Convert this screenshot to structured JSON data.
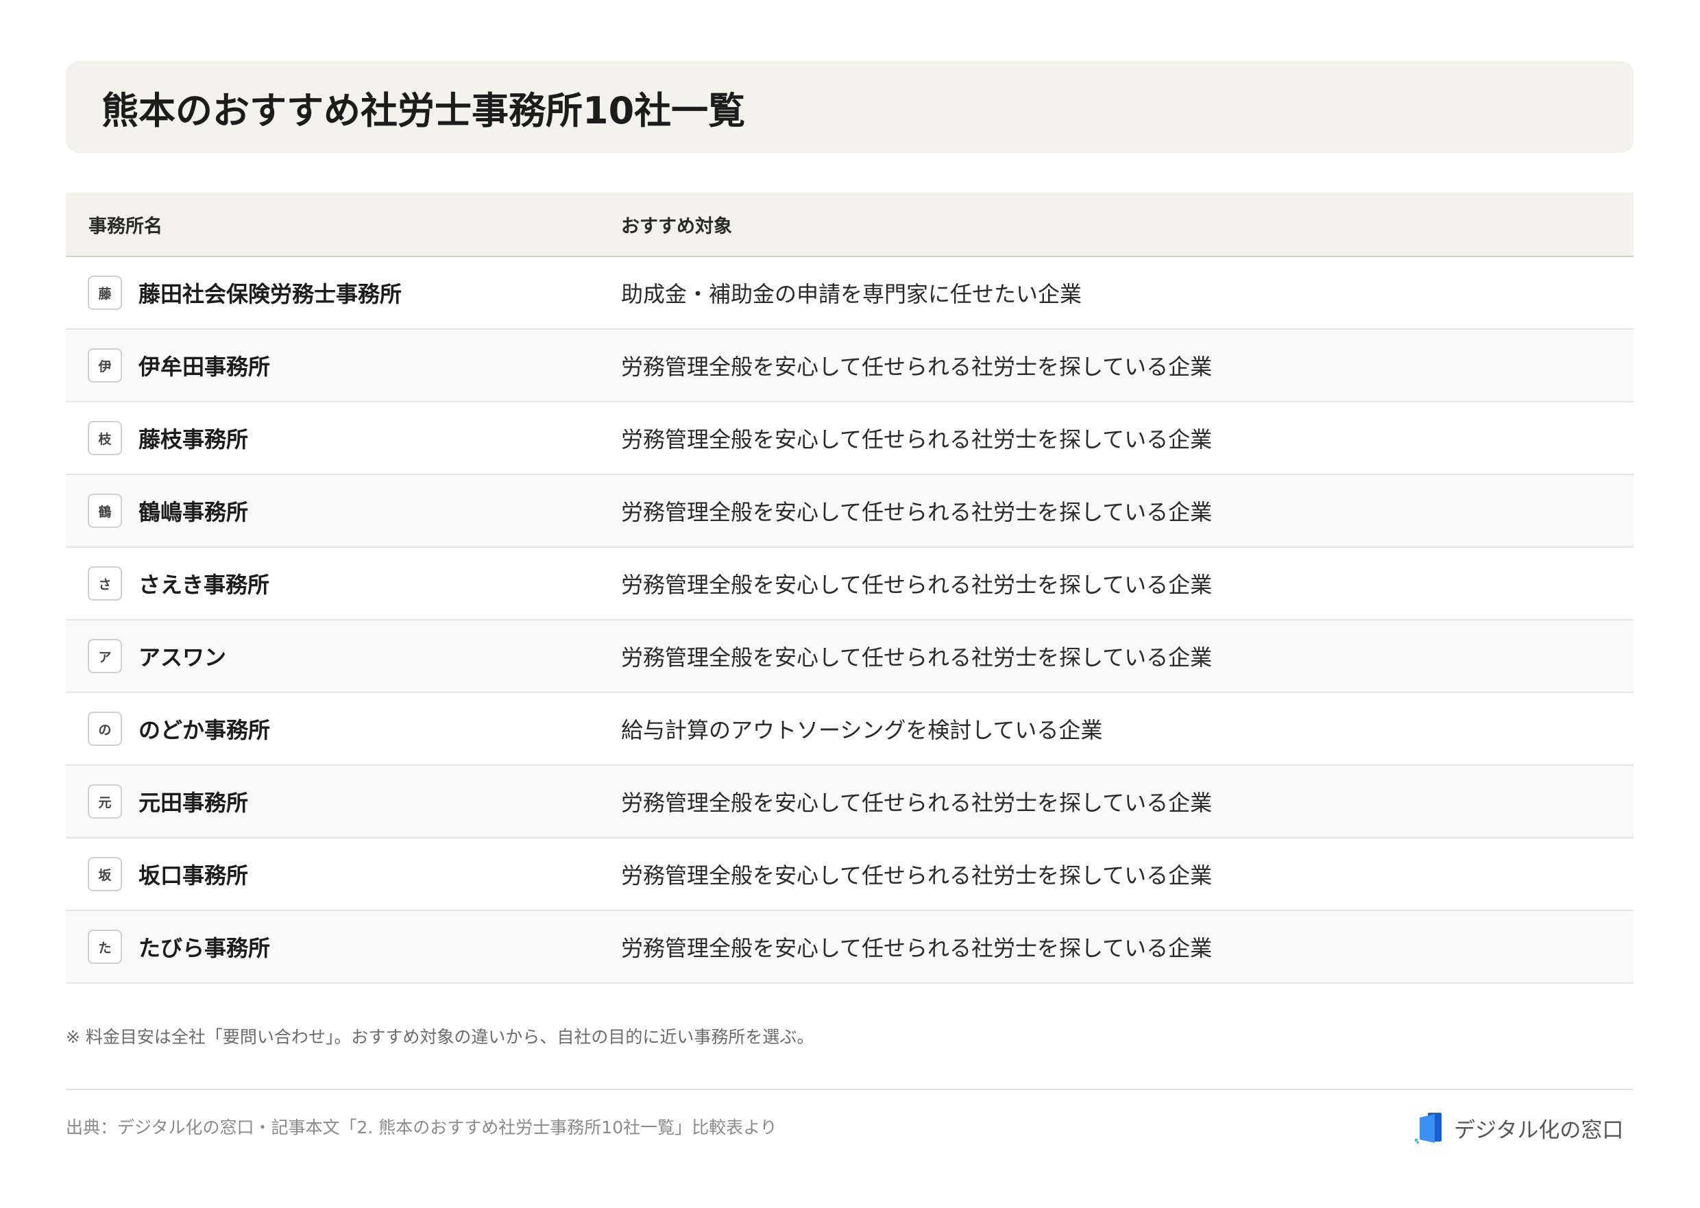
{
  "title": "熊本のおすすめ社労士事務所10社一覧",
  "table": {
    "headers": {
      "name": "事務所名",
      "target": "おすすめ対象"
    },
    "rows": [
      {
        "initial": "藤",
        "name": "藤田社会保険労務士事務所",
        "target": "助成金・補助金の申請を専門家に任せたい企業"
      },
      {
        "initial": "伊",
        "name": "伊牟田事務所",
        "target": "労務管理全般を安心して任せられる社労士を探している企業"
      },
      {
        "initial": "枝",
        "name": "藤枝事務所",
        "target": "労務管理全般を安心して任せられる社労士を探している企業"
      },
      {
        "initial": "鶴",
        "name": "鶴嶋事務所",
        "target": "労務管理全般を安心して任せられる社労士を探している企業"
      },
      {
        "initial": "さ",
        "name": "さえき事務所",
        "target": "労務管理全般を安心して任せられる社労士を探している企業"
      },
      {
        "initial": "ア",
        "name": "アスワン",
        "target": "労務管理全般を安心して任せられる社労士を探している企業"
      },
      {
        "initial": "の",
        "name": "のどか事務所",
        "target": "給与計算のアウトソーシングを検討している企業"
      },
      {
        "initial": "元",
        "name": "元田事務所",
        "target": "労務管理全般を安心して任せられる社労士を探している企業"
      },
      {
        "initial": "坂",
        "name": "坂口事務所",
        "target": "労務管理全般を安心して任せられる社労士を探している企業"
      },
      {
        "initial": "た",
        "name": "たびら事務所",
        "target": "労務管理全般を安心して任せられる社労士を探している企業"
      }
    ]
  },
  "note": "※ 料金目安は全社「要問い合わせ」。おすすめ対象の違いから、自社の目的に近い事務所を選ぶ。",
  "source": "出典：デジタル化の窓口・記事本文「2. 熊本のおすすめ社労士事務所10社一覧」比較表より",
  "logo": {
    "text": "デジタル化の窓口",
    "icon": "window-logo-icon"
  },
  "colors": {
    "title_background": "#f4f2ec",
    "header_background": "#f4f2ec",
    "alt_row_background": "#f9f9f9",
    "logo_blue": "#1a5fc8",
    "logo_light_blue": "#3a8ff0",
    "logo_cyan": "#29c5e8"
  }
}
